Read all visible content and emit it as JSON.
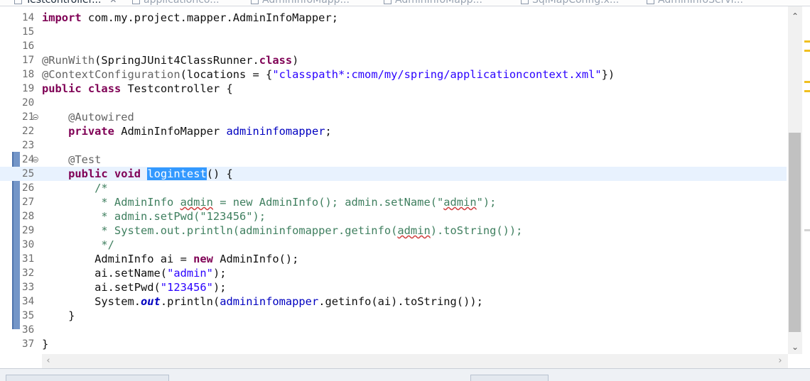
{
  "tabs": [
    {
      "label": "Testcontroller...",
      "active": true
    },
    {
      "label": "applicationco...",
      "active": false
    },
    {
      "label": "AdminInfoMapp...",
      "active": false
    },
    {
      "label": "AdminInfoMapp...",
      "active": false
    },
    {
      "label": "SqlMapConfig.x...",
      "active": false
    },
    {
      "label": "AdminInfoServi...",
      "active": false
    }
  ],
  "editor": {
    "current_line": 25,
    "selected_text": "logintest",
    "lines": [
      {
        "no": "14",
        "fold": false,
        "tokens": [
          {
            "t": "import",
            "c": "kw"
          },
          {
            "t": " com.my.project.mapper.AdminInfoMapper;",
            "c": ""
          }
        ]
      },
      {
        "no": "15",
        "fold": false,
        "tokens": []
      },
      {
        "no": "16",
        "fold": false,
        "tokens": []
      },
      {
        "no": "17",
        "fold": false,
        "tokens": [
          {
            "t": "@RunWith",
            "c": "an"
          },
          {
            "t": "(SpringJUnit4ClassRunner.",
            "c": ""
          },
          {
            "t": "class",
            "c": "kw"
          },
          {
            "t": ")",
            "c": ""
          }
        ]
      },
      {
        "no": "18",
        "fold": false,
        "tokens": [
          {
            "t": "@ContextConfiguration",
            "c": "an"
          },
          {
            "t": "(locations = {",
            "c": ""
          },
          {
            "t": "\"classpath*:cmom/my/spring/applicationcontext.xml\"",
            "c": "st"
          },
          {
            "t": "})",
            "c": ""
          }
        ]
      },
      {
        "no": "19",
        "fold": false,
        "tokens": [
          {
            "t": "public",
            "c": "kw"
          },
          {
            "t": " ",
            "c": ""
          },
          {
            "t": "class",
            "c": "kw"
          },
          {
            "t": " Testcontroller {",
            "c": ""
          }
        ]
      },
      {
        "no": "20",
        "fold": false,
        "tokens": []
      },
      {
        "no": "21",
        "fold": true,
        "tokens": [
          {
            "t": "    ",
            "c": ""
          },
          {
            "t": "@Autowired",
            "c": "an"
          }
        ]
      },
      {
        "no": "22",
        "fold": false,
        "tokens": [
          {
            "t": "    ",
            "c": ""
          },
          {
            "t": "private",
            "c": "kw"
          },
          {
            "t": " AdminInfoMapper ",
            "c": ""
          },
          {
            "t": "admininfomapper",
            "c": "fld"
          },
          {
            "t": ";",
            "c": ""
          }
        ]
      },
      {
        "no": "23",
        "fold": false,
        "tokens": []
      },
      {
        "no": "24",
        "fold": true,
        "tokens": [
          {
            "t": "    ",
            "c": ""
          },
          {
            "t": "@Test",
            "c": "an"
          }
        ]
      },
      {
        "no": "25",
        "fold": false,
        "tokens": [
          {
            "t": "    ",
            "c": ""
          },
          {
            "t": "public",
            "c": "kw"
          },
          {
            "t": " ",
            "c": ""
          },
          {
            "t": "void",
            "c": "kw"
          },
          {
            "t": " ",
            "c": ""
          },
          {
            "t": "logintest",
            "c": "sel"
          },
          {
            "t": "() {",
            "c": ""
          }
        ]
      },
      {
        "no": "26",
        "fold": false,
        "tokens": [
          {
            "t": "        /*",
            "c": "cm"
          }
        ]
      },
      {
        "no": "27",
        "fold": false,
        "tokens": [
          {
            "t": "         * AdminInfo ",
            "c": "cm"
          },
          {
            "t": "admin",
            "c": "cm sp"
          },
          {
            "t": " = new AdminInfo(); admin.setName(\"",
            "c": "cm"
          },
          {
            "t": "admin",
            "c": "cm sp"
          },
          {
            "t": "\");",
            "c": "cm"
          }
        ]
      },
      {
        "no": "28",
        "fold": false,
        "tokens": [
          {
            "t": "         * admin.setPwd(\"123456\");",
            "c": "cm"
          }
        ]
      },
      {
        "no": "29",
        "fold": false,
        "tokens": [
          {
            "t": "         * System.out.println(admininfomapper.getinfo(",
            "c": "cm"
          },
          {
            "t": "admin",
            "c": "cm sp"
          },
          {
            "t": ").toString());",
            "c": "cm"
          }
        ]
      },
      {
        "no": "30",
        "fold": false,
        "tokens": [
          {
            "t": "         */",
            "c": "cm"
          }
        ]
      },
      {
        "no": "31",
        "fold": false,
        "tokens": [
          {
            "t": "        AdminInfo ai = ",
            "c": ""
          },
          {
            "t": "new",
            "c": "kw"
          },
          {
            "t": " AdminInfo();",
            "c": ""
          }
        ]
      },
      {
        "no": "32",
        "fold": false,
        "tokens": [
          {
            "t": "        ai.setName(",
            "c": ""
          },
          {
            "t": "\"admin\"",
            "c": "st"
          },
          {
            "t": ");",
            "c": ""
          }
        ]
      },
      {
        "no": "33",
        "fold": false,
        "tokens": [
          {
            "t": "        ai.setPwd(",
            "c": ""
          },
          {
            "t": "\"123456\"",
            "c": "st"
          },
          {
            "t": ");",
            "c": ""
          }
        ]
      },
      {
        "no": "34",
        "fold": false,
        "tokens": [
          {
            "t": "        System.",
            "c": ""
          },
          {
            "t": "out",
            "c": "sfld"
          },
          {
            "t": ".println(",
            "c": ""
          },
          {
            "t": "admininfomapper",
            "c": "fld"
          },
          {
            "t": ".getinfo(ai).toString());",
            "c": ""
          }
        ]
      },
      {
        "no": "35",
        "fold": false,
        "tokens": [
          {
            "t": "    }",
            "c": ""
          }
        ]
      },
      {
        "no": "36",
        "fold": false,
        "tokens": []
      },
      {
        "no": "37",
        "fold": false,
        "tokens": [
          {
            "t": "}",
            "c": ""
          }
        ]
      }
    ]
  },
  "icons": {
    "tab_close": "close-icon",
    "scroll_up": "chevron-up-icon",
    "scroll_down": "chevron-down-icon",
    "scroll_left": "chevron-left-icon",
    "scroll_right": "chevron-right-icon",
    "fold": "fold-toggle-icon"
  },
  "colors": {
    "keyword": "#7f0055",
    "string": "#2a00ff",
    "annotation": "#646464",
    "comment": "#3f7f5f",
    "field": "#0000c0",
    "selection": "#3399ff",
    "current_line": "#e8f2fe",
    "change_ruler": "#7496c8"
  }
}
